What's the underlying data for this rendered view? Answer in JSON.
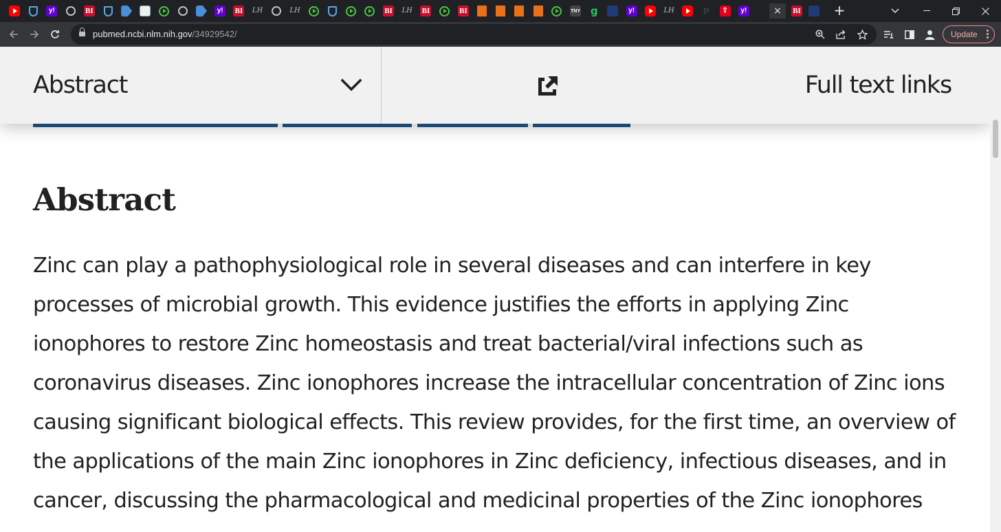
{
  "browser": {
    "tabs": [
      {
        "icon": "youtube-icon",
        "text": ""
      },
      {
        "icon": "shield-icon",
        "text": ""
      },
      {
        "icon": "yahoo-icon",
        "text": "y!"
      },
      {
        "icon": "globe-icon",
        "text": ""
      },
      {
        "icon": "business-insider-icon",
        "text": "BI"
      },
      {
        "icon": "shield-icon",
        "text": ""
      },
      {
        "icon": "arrow-icon",
        "text": ""
      },
      {
        "icon": "dots-icon",
        "text": ""
      },
      {
        "icon": "rumble-icon",
        "text": ""
      },
      {
        "icon": "globe-icon",
        "text": ""
      },
      {
        "icon": "arrow-icon",
        "text": ""
      },
      {
        "icon": "yahoo-icon",
        "text": "y!"
      },
      {
        "icon": "business-insider-icon",
        "text": "BI"
      },
      {
        "icon": "lh-icon",
        "text": "LH"
      },
      {
        "icon": "globe-icon",
        "text": ""
      },
      {
        "icon": "lh-icon",
        "text": "LH"
      },
      {
        "icon": "rumble-icon",
        "text": ""
      },
      {
        "icon": "shield-icon",
        "text": ""
      },
      {
        "icon": "rumble-icon",
        "text": ""
      },
      {
        "icon": "rumble-icon",
        "text": ""
      },
      {
        "icon": "business-insider-icon",
        "text": "BI"
      },
      {
        "icon": "lh-icon",
        "text": "LH"
      },
      {
        "icon": "business-insider-icon",
        "text": "BI"
      },
      {
        "icon": "rumble-icon",
        "text": ""
      },
      {
        "icon": "business-insider-icon",
        "text": "BI"
      },
      {
        "icon": "bookmark-icon",
        "text": ""
      },
      {
        "icon": "bookmark-icon",
        "text": ""
      },
      {
        "icon": "bookmark-icon",
        "text": ""
      },
      {
        "icon": "bookmark-icon",
        "text": ""
      },
      {
        "icon": "rumble-icon",
        "text": ""
      },
      {
        "icon": "news-icon",
        "text": "TNY"
      },
      {
        "icon": "g-icon",
        "text": "g"
      },
      {
        "icon": "seal-icon",
        "text": ""
      },
      {
        "icon": "yahoo-icon",
        "text": "y!"
      },
      {
        "icon": "youtube-icon",
        "text": ""
      },
      {
        "icon": "lh-icon",
        "text": "LH"
      },
      {
        "icon": "youtube-icon",
        "text": ""
      },
      {
        "icon": "p-icon",
        "text": "P"
      },
      {
        "icon": "upload-icon",
        "text": "⇧"
      },
      {
        "icon": "yahoo-icon",
        "text": "y!"
      }
    ],
    "after_tabs": [
      {
        "icon": "business-insider-icon",
        "text": "BI"
      },
      {
        "icon": "seal-icon",
        "text": ""
      }
    ],
    "active_tab_close": "×",
    "new_tab": "+",
    "url_host": "pubmed.ncbi.nlm.nih.gov",
    "url_path": "/34929542/",
    "update_label": "Update"
  },
  "page": {
    "section_select": "Abstract",
    "full_text_links": "Full text links",
    "abstract_heading": "Abstract",
    "abstract_text": "Zinc can play a pathophysiological role in several diseases and can interfere in key processes of microbial growth. This evidence justifies the efforts in applying Zinc ionophores to restore Zinc homeostasis and treat bacterial/viral infections such as coronavirus diseases. Zinc ionophores increase the intracellular concentration of Zinc ions causing significant biological effects. This review provides, for the first time, an overview of the applications of the main Zinc ionophores in Zinc deficiency, infectious diseases, and in cancer, discussing the pharmacological and medicinal properties of the Zinc ionophores"
  },
  "colors": {
    "tabstrip": "#202124",
    "toolbar": "#35363a",
    "sticky_bar": "#f1f1f1",
    "tab_underline": "#20558a",
    "text": "#212121"
  }
}
